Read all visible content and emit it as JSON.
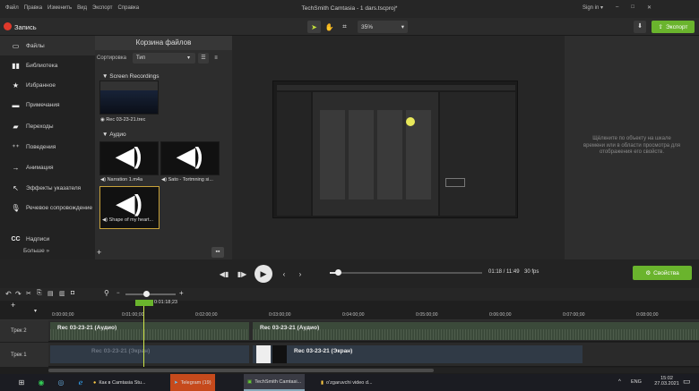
{
  "menu": [
    "Файл",
    "Правка",
    "Изменить",
    "Вид",
    "Экспорт",
    "Справка"
  ],
  "window_title": "TechSmith Camtasia - 1 dars.tscproj*",
  "account": {
    "signin": "Sign in ▾",
    "minimize": "–",
    "maximize": "□",
    "close": "✕"
  },
  "toolbar": {
    "record_label": "Запись",
    "zoom": "35%",
    "export_label": "Экспорт"
  },
  "sidebar": {
    "items": [
      {
        "label": "Файлы",
        "icon": "film-strip-icon"
      },
      {
        "label": "Библиотека",
        "icon": "library-icon"
      },
      {
        "label": "Избранное",
        "icon": "star-icon"
      },
      {
        "label": "Примечания",
        "icon": "annotation-icon"
      },
      {
        "label": "Переходы",
        "icon": "transition-icon"
      },
      {
        "label": "Поведения",
        "icon": "behavior-icon"
      },
      {
        "label": "Анимация",
        "icon": "animation-icon"
      },
      {
        "label": "Эффекты указателя",
        "icon": "cursor-effects-icon"
      },
      {
        "label": "Речевое сопровождение",
        "icon": "microphone-icon"
      },
      {
        "label": "Надписи",
        "icon": "captions-icon"
      }
    ],
    "more": "Больше »"
  },
  "bin": {
    "title": "Корзина файлов",
    "sort_label": "Сортировка",
    "sort_value": "Тип",
    "group_recordings": "▼ Screen Recordings",
    "group_audio": "▼ Аудио",
    "items": {
      "recording": "◉ Rec 03-23-21.trec",
      "audio1": "◀) Narration 1.m4a",
      "audio2": "◀) Sato - Tortmning si...",
      "audio3": "◀) Shape of my heart..."
    },
    "add": "+",
    "grid": "▪▪"
  },
  "properties": {
    "hint": "Щёлкните по объекту на шкале времени или в области просмотра для отображения его свойств.",
    "button": "Свойства"
  },
  "player": {
    "time": "01:18 / 11:49",
    "fps": "30 fps"
  },
  "timeline": {
    "playhead_time": "0:01:18;23",
    "ticks": [
      "0:00:00;00",
      "0:01:00;00",
      "0:02:00;00",
      "0:03:00;00",
      "0:04:00;00",
      "0:05:00;00",
      "0:06:00;00",
      "0:07:00;00",
      "0:08:00;00"
    ],
    "track2_label": "Трек 2",
    "track1_label": "Трек 1",
    "clip_a1": "Rec 03-23-21 (Аудио)",
    "clip_a2": "Rec 03-23-21 (Аудио)",
    "clip_v1": "Rec 03-23-21 (Экран)",
    "clip_v2": "Rec 03-23-21 (Экран)"
  },
  "taskbar": {
    "apps": [
      {
        "label": "Как в Camtasia Stu...",
        "icon": "chrome-icon"
      },
      {
        "label": "Telegram (19)",
        "icon": "telegram-icon"
      },
      {
        "label": "TechSmith Camtasi...",
        "icon": "camtasia-icon"
      },
      {
        "label": "o'zgaruvchi video d...",
        "icon": "folder-icon"
      }
    ],
    "tray": {
      "lang": "ENG",
      "time": "15:02",
      "date": "27.03.2021"
    }
  }
}
